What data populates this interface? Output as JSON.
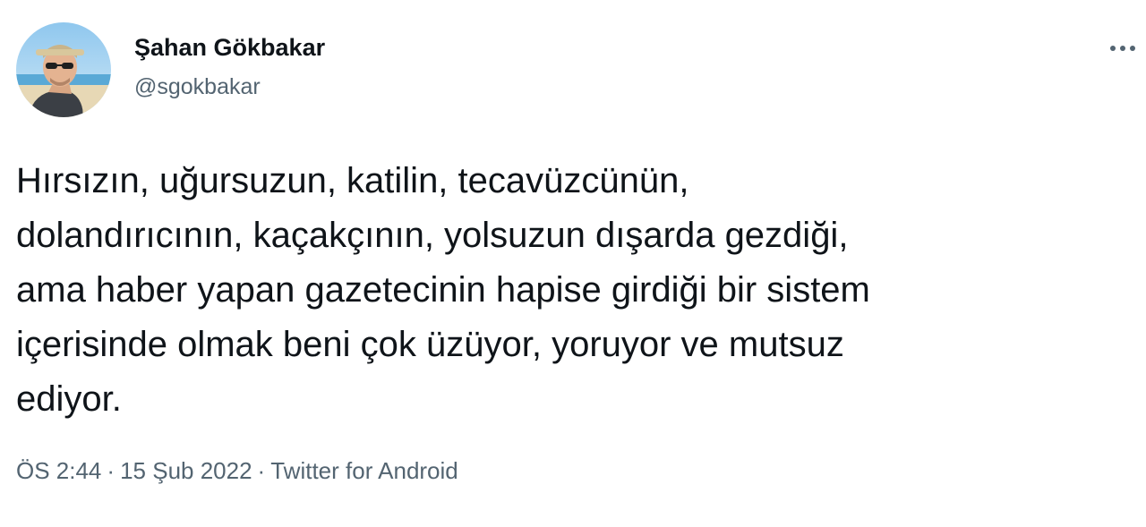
{
  "colors": {
    "text_primary": "#0f1419",
    "text_secondary": "#536471",
    "background": "#ffffff"
  },
  "author": {
    "name": "Şahan Gökbakar",
    "handle": "@sgokbakar",
    "avatar_icon": "profile-photo"
  },
  "more_icon": "more-horizontal-icon",
  "tweet": {
    "lines": [
      "Hırsızın, uğursuzun, katilin, tecavüzcünün,",
      "dolandırıcının, kaçakçının, yolsuzun dışarda gezdiği,",
      "ama haber yapan gazetecinin hapise girdiği bir sistem",
      "içerisinde olmak beni çok üzüyor, yoruyor ve mutsuz",
      "ediyor."
    ]
  },
  "meta": {
    "time": "ÖS 2:44",
    "separator": "·",
    "date": "15 Şub 2022",
    "source": "Twitter for Android"
  }
}
